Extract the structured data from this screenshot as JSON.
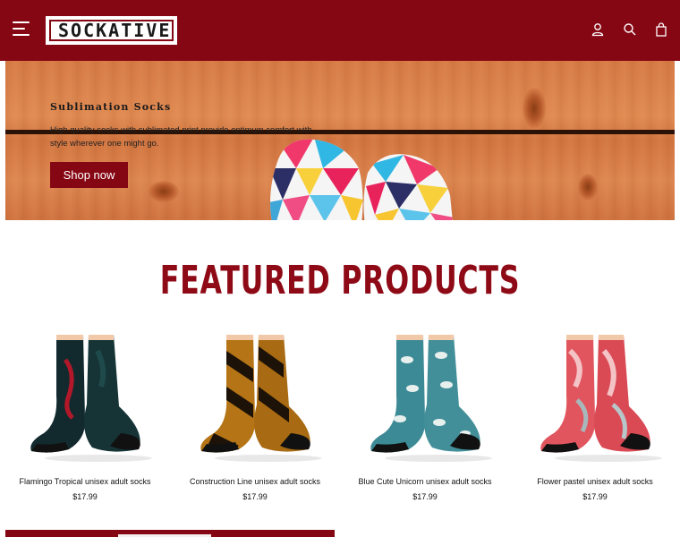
{
  "header": {
    "logo_text": "SOCKATIVE",
    "icons": [
      "menu-icon",
      "user-icon",
      "search-icon",
      "bag-icon"
    ]
  },
  "hero": {
    "title": "Sublimation Socks",
    "description": "High quality socks with sublimated print provide optimum comfort with style wherever one might go.",
    "cta_label": "Shop now"
  },
  "featured": {
    "title": "FEATURED PRODUCTS",
    "products": [
      {
        "name": "Flamingo Tropical unisex adult socks",
        "price": "$17.99"
      },
      {
        "name": "Construction Line unisex adult socks",
        "price": "$17.99"
      },
      {
        "name": "Blue Cute Unicorn unisex adult socks",
        "price": "$17.99"
      },
      {
        "name": "Flower pastel unisex adult socks",
        "price": "$17.99"
      }
    ]
  },
  "colors": {
    "brand": "#860714",
    "title": "#8e0a16",
    "wood": "#d67b46"
  }
}
